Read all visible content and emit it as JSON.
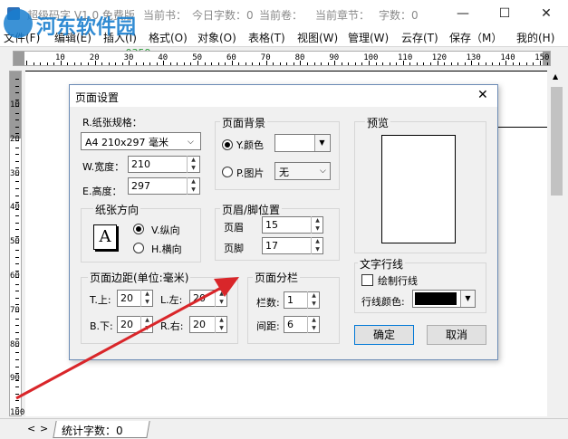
{
  "titlebar": {
    "app_title": "超级码字 V1.0 免费版",
    "current_book": "当前书：",
    "today_count": "今日字数：0",
    "current_volume": "当前卷：",
    "current_chapter": "当前章节：",
    "word_count": "字数：0"
  },
  "watermark": {
    "name": "河东软件园",
    "url": "www.pc0359.cn"
  },
  "menu": [
    "文件(F)",
    "编辑(E)",
    "插入(I)",
    "格式(O)",
    "对象(O)",
    "表格(T)",
    "视图(W)",
    "管理(W)",
    "云存(T)",
    "保存（M）",
    "我的(H)"
  ],
  "ruler": {
    "h_labels": [
      "10",
      "20",
      "30",
      "40",
      "50",
      "60",
      "70",
      "80",
      "90",
      "100",
      "110",
      "120",
      "130",
      "140",
      "150"
    ],
    "v_labels": [
      "10",
      "20",
      "30",
      "40",
      "50",
      "60",
      "70",
      "80",
      "90",
      "100"
    ]
  },
  "status": {
    "count_label": "统计字数：0"
  },
  "dialog": {
    "title": "页面设置",
    "paper": {
      "label": "R.纸张规格：",
      "size_value": "A4 210x297 毫米",
      "width_label": "W.宽度：",
      "width_value": "210",
      "height_label": "E.高度：",
      "height_value": "297"
    },
    "orientation": {
      "label": "纸张方向",
      "portrait": "V.纵向",
      "landscape": "H.横向",
      "icon_letter": "A"
    },
    "background": {
      "label": "页面背景",
      "color_label": "Y.颜色",
      "image_label": "P.图片",
      "image_value": "无"
    },
    "header_footer": {
      "label": "页眉/脚位置",
      "header_label": "页眉",
      "header_value": "15",
      "footer_label": "页脚",
      "footer_value": "17"
    },
    "margins": {
      "label": "页面边距(单位:毫米)",
      "top_label": "T.上:",
      "top_value": "20",
      "left_label": "L.左:",
      "left_value": "20",
      "bottom_label": "B.下:",
      "bottom_value": "20",
      "right_label": "R.右:",
      "right_value": "20"
    },
    "columns": {
      "label": "页面分栏",
      "count_label": "栏数:",
      "count_value": "1",
      "spacing_label": "间距:",
      "spacing_value": "6"
    },
    "preview": {
      "label": "预览"
    },
    "text_lines": {
      "label": "文字行线",
      "draw_label": "绘制行线",
      "color_label": "行线颜色:",
      "color_value": "#000000"
    },
    "ok_label": "确定",
    "cancel_label": "取消"
  },
  "colors": {
    "arrow": "#d9262a",
    "accent": "#0078d7",
    "watermark": "#1a7fcf"
  }
}
